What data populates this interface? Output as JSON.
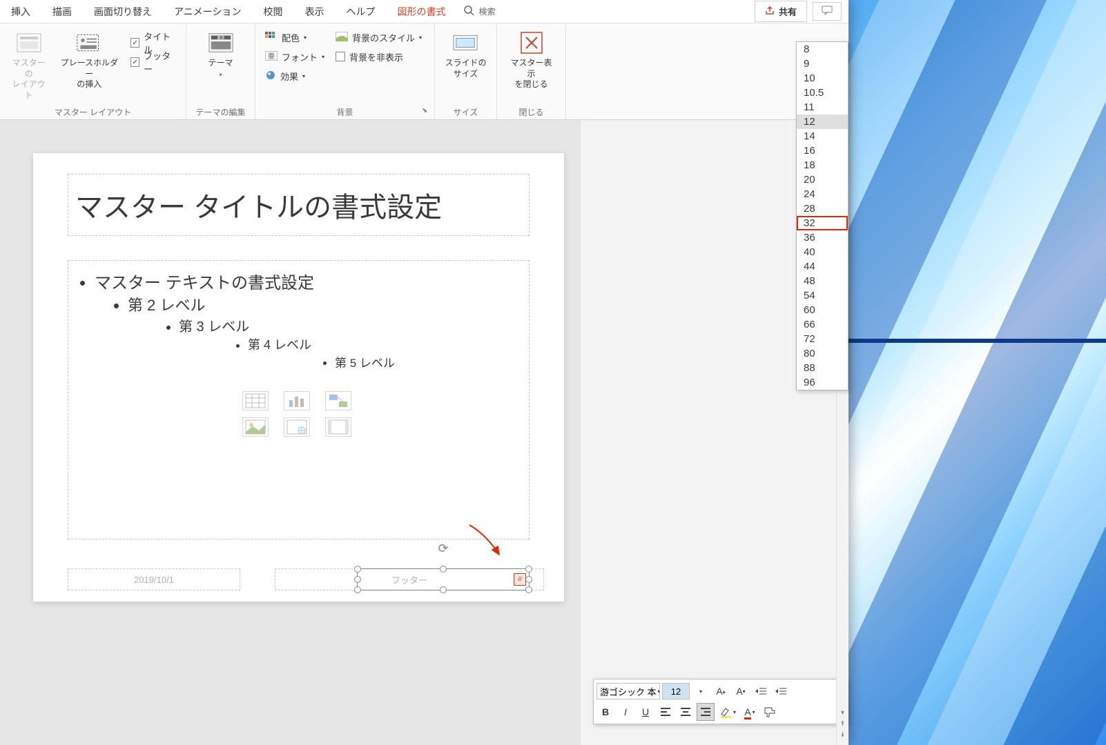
{
  "menu": {
    "items": [
      "挿入",
      "描画",
      "画面切り替え",
      "アニメーション",
      "校閲",
      "表示",
      "ヘルプ",
      "図形の書式"
    ],
    "active_index": 7,
    "search_label": "検索",
    "share_label": "共有"
  },
  "ribbon": {
    "groups": {
      "master_layout": {
        "label": "マスター レイアウト",
        "master_layout_btn": "マスターの\nレイアウト",
        "placeholder_btn": "プレースホルダー\nの挿入",
        "title_checkbox": "タイトル",
        "footer_checkbox": "フッター"
      },
      "theme_edit": {
        "label": "テーマの編集",
        "theme_btn": "テーマ"
      },
      "background": {
        "label": "背景",
        "colors": "配色",
        "fonts": "フォント",
        "effects": "効果",
        "bg_styles": "背景のスタイル",
        "hide_bg": "背景を非表示"
      },
      "size": {
        "label": "サイズ",
        "slide_size": "スライドの\nサイズ"
      },
      "close": {
        "label": "閉じる",
        "close_master": "マスター表示\nを閉じる"
      }
    }
  },
  "slide": {
    "title_placeholder": "マスター タイトルの書式設定",
    "level1": "マスター テキストの書式設定",
    "level2": "第 2 レベル",
    "level3": "第 3 レベル",
    "level4": "第 4 レベル",
    "level5": "第 5 レベル",
    "date_text": "2019/10/1",
    "footer_text": "フッター",
    "slidenum_char": "#"
  },
  "font_sizes": [
    "8",
    "9",
    "10",
    "10.5",
    "11",
    "12",
    "14",
    "16",
    "18",
    "20",
    "24",
    "28",
    "32",
    "36",
    "40",
    "44",
    "48",
    "54",
    "60",
    "66",
    "72",
    "80",
    "88",
    "96"
  ],
  "font_size_hover": "12",
  "font_size_highlight": "32",
  "mini_toolbar": {
    "font_name": "游ゴシック 本",
    "font_size": "12"
  }
}
